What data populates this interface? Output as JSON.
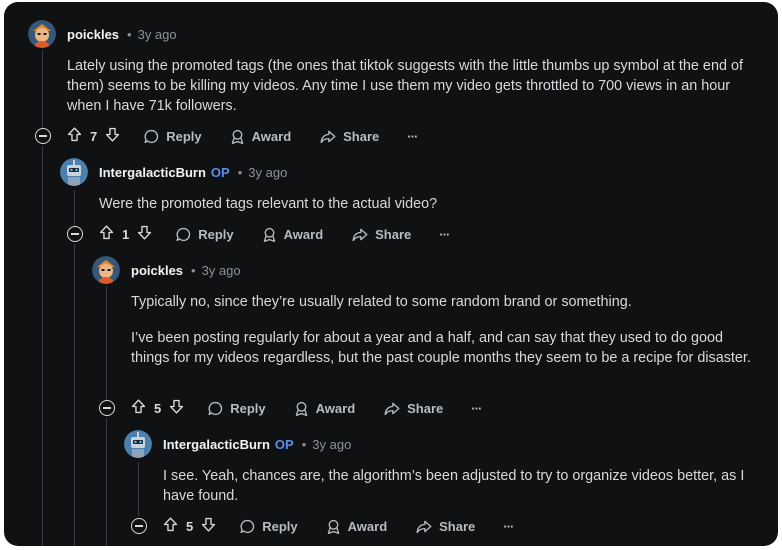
{
  "comments": [
    {
      "author": "poickles",
      "op_badge": "",
      "separator": "•",
      "time": "3y ago",
      "paragraphs": [
        "Lately using the promoted tags (the ones that tiktok suggests with the little thumbs up symbol at the end of them) seems to be killing my videos. Any time I use them my video gets throttled to 700 views in an hour when I have 71k followers."
      ],
      "score": "7",
      "reply_label": "Reply",
      "award_label": "Award",
      "share_label": "Share",
      "more_label": "···"
    },
    {
      "author": "IntergalacticBurn",
      "op_badge": "OP",
      "separator": "•",
      "time": "3y ago",
      "paragraphs": [
        "Were the promoted tags relevant to the actual video?"
      ],
      "score": "1",
      "reply_label": "Reply",
      "award_label": "Award",
      "share_label": "Share",
      "more_label": "···"
    },
    {
      "author": "poickles",
      "op_badge": "",
      "separator": "•",
      "time": "3y ago",
      "paragraphs": [
        "Typically no, since they’re usually related to some random brand or something.",
        "I’ve been posting regularly for about a year and a half, and can say that they used to do good things for my videos regardless, but the past couple months they seem to be a recipe for disaster."
      ],
      "score": "5",
      "reply_label": "Reply",
      "award_label": "Award",
      "share_label": "Share",
      "more_label": "···"
    },
    {
      "author": "IntergalacticBurn",
      "op_badge": "OP",
      "separator": "•",
      "time": "3y ago",
      "paragraphs": [
        "I see. Yeah, chances are, the algorithm’s been adjusted to try to organize videos better, as I have found."
      ],
      "score": "5",
      "reply_label": "Reply",
      "award_label": "Award",
      "share_label": "Share",
      "more_label": "···"
    }
  ],
  "colors": {
    "background": "#0f1113",
    "text": "#d7dadc",
    "muted": "#8a9198",
    "op_badge": "#5b8def",
    "thread_line": "#343a40"
  },
  "icons": [
    "collapse-icon",
    "upvote-icon",
    "downvote-icon",
    "reply-bubble-icon",
    "award-icon",
    "share-arrow-icon",
    "more-icon"
  ]
}
